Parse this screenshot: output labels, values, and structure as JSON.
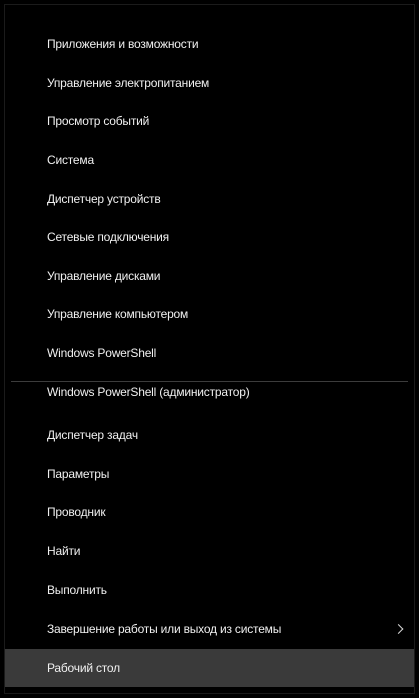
{
  "menu": {
    "group1": [
      {
        "label": "Приложения и возможности"
      },
      {
        "label": "Управление электропитанием"
      },
      {
        "label": "Просмотр событий"
      },
      {
        "label": "Система"
      },
      {
        "label": "Диспетчер устройств"
      },
      {
        "label": "Сетевые подключения"
      },
      {
        "label": "Управление дисками"
      },
      {
        "label": "Управление компьютером"
      },
      {
        "label": "Windows PowerShell"
      },
      {
        "label": "Windows PowerShell (администратор)"
      }
    ],
    "group2": [
      {
        "label": "Диспетчер задач"
      },
      {
        "label": "Параметры"
      },
      {
        "label": "Проводник"
      },
      {
        "label": "Найти"
      },
      {
        "label": "Выполнить"
      }
    ],
    "group3": [
      {
        "label": "Завершение работы или выход из системы",
        "has_submenu": true,
        "submenu_icon": "chevron-right-icon"
      },
      {
        "label": "Рабочий стол",
        "highlighted": true
      }
    ]
  },
  "colors": {
    "background": "#000000",
    "text": "#f0f0f0",
    "highlight": "#3a3a3a",
    "separator": "#3c3c3c"
  }
}
